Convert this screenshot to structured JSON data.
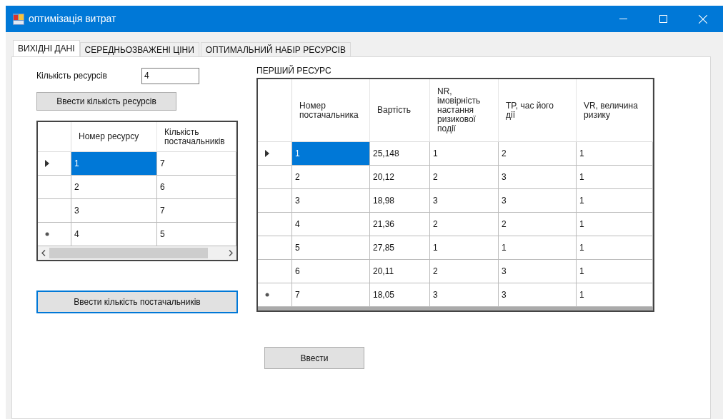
{
  "window": {
    "title": "оптимізація витрат"
  },
  "tabs": [
    {
      "label": "ВИХІДНІ ДАНІ",
      "selected": true
    },
    {
      "label": "СЕРЕДНЬОЗВАЖЕНІ ЦІНИ",
      "selected": false
    },
    {
      "label": "ОПТИМАЛЬНИЙ НАБІР РЕСУРСІВ",
      "selected": false
    }
  ],
  "resource_count": {
    "label": "Кількість ресурсів",
    "value": "4"
  },
  "enter_resources_button": "Ввести кількість ресурсів",
  "resources_table": {
    "columns": [
      "Номер ресурсу",
      "Кількість постачальників"
    ],
    "rows": [
      {
        "kind": "current",
        "cells": [
          {
            "text": "1",
            "selected": true
          },
          {
            "text": "7",
            "selected": false
          }
        ]
      },
      {
        "kind": "plain",
        "cells": [
          {
            "text": "2",
            "selected": false
          },
          {
            "text": "6",
            "selected": false
          }
        ]
      },
      {
        "kind": "plain",
        "cells": [
          {
            "text": "3",
            "selected": false
          },
          {
            "text": "7",
            "selected": false
          }
        ]
      },
      {
        "kind": "new",
        "cells": [
          {
            "text": "4",
            "selected": false
          },
          {
            "text": "5",
            "selected": false
          }
        ]
      }
    ]
  },
  "enter_suppliers_button": "Ввести кількість постачальників",
  "suppliers_title": "ПЕРШИЙ РЕСУРС",
  "suppliers_table": {
    "columns": [
      "Номер постачальника",
      "Вартість",
      "NR, імовірність настання ризикової події",
      "TP, час його дії",
      "VR, величина ризику"
    ],
    "rows": [
      {
        "kind": "current",
        "cells": [
          {
            "text": "1",
            "selected": true
          },
          {
            "text": "25,148",
            "selected": false
          },
          {
            "text": "1",
            "selected": false
          },
          {
            "text": "2",
            "selected": false
          },
          {
            "text": "1",
            "selected": false
          }
        ]
      },
      {
        "kind": "plain",
        "cells": [
          {
            "text": "2",
            "selected": false
          },
          {
            "text": "20,12",
            "selected": false
          },
          {
            "text": "2",
            "selected": false
          },
          {
            "text": "3",
            "selected": false
          },
          {
            "text": "1",
            "selected": false
          }
        ]
      },
      {
        "kind": "plain",
        "cells": [
          {
            "text": "3",
            "selected": false
          },
          {
            "text": "18,98",
            "selected": false
          },
          {
            "text": "3",
            "selected": false
          },
          {
            "text": "3",
            "selected": false
          },
          {
            "text": "1",
            "selected": false
          }
        ]
      },
      {
        "kind": "plain",
        "cells": [
          {
            "text": "4",
            "selected": false
          },
          {
            "text": "21,36",
            "selected": false
          },
          {
            "text": "2",
            "selected": false
          },
          {
            "text": "2",
            "selected": false
          },
          {
            "text": "1",
            "selected": false
          }
        ]
      },
      {
        "kind": "plain",
        "cells": [
          {
            "text": "5",
            "selected": false
          },
          {
            "text": "27,85",
            "selected": false
          },
          {
            "text": "1",
            "selected": false
          },
          {
            "text": "1",
            "selected": false
          },
          {
            "text": "1",
            "selected": false
          }
        ]
      },
      {
        "kind": "plain",
        "cells": [
          {
            "text": "6",
            "selected": false
          },
          {
            "text": "20,11",
            "selected": false
          },
          {
            "text": "2",
            "selected": false
          },
          {
            "text": "3",
            "selected": false
          },
          {
            "text": "1",
            "selected": false
          }
        ]
      },
      {
        "kind": "new",
        "cells": [
          {
            "text": "7",
            "selected": false
          },
          {
            "text": "18,05",
            "selected": false
          },
          {
            "text": "3",
            "selected": false
          },
          {
            "text": "3",
            "selected": false
          },
          {
            "text": "1",
            "selected": false
          }
        ]
      }
    ]
  },
  "enter_button": "Ввести"
}
